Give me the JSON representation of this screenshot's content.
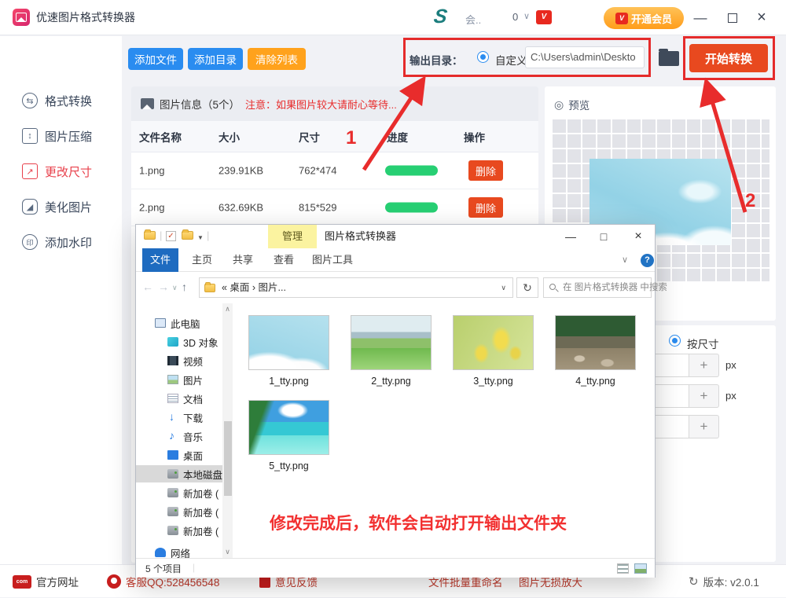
{
  "app": {
    "title": "优速图片格式转换器",
    "titlebar": {
      "logo": "S",
      "account": "会..",
      "count": "0",
      "chevron": "∨",
      "vip_badge": "V",
      "upgrade": "开通会员",
      "minimize": "—",
      "close": "×"
    },
    "sidebar": {
      "items": [
        {
          "label": "格式转换",
          "icon_glyph": "⇆"
        },
        {
          "label": "图片压缩",
          "icon_glyph": "↕"
        },
        {
          "label": "更改尺寸",
          "icon_glyph": "↗"
        },
        {
          "label": "美化图片",
          "icon_glyph": "◢"
        },
        {
          "label": "添加水印",
          "icon_glyph": "印"
        }
      ]
    },
    "toolbar": {
      "add_files": "添加文件",
      "add_folder": "添加目录",
      "clear_list": "清除列表"
    },
    "output": {
      "label": "输出目录：",
      "custom": "自定义",
      "path": "C:\\Users\\admin\\Deskto",
      "start": "开始转换"
    },
    "table": {
      "panel_title": "图片信息（5个）",
      "warning": "注意：如果图片较大请耐心等待...",
      "columns": {
        "name": "文件名称",
        "size": "大小",
        "dims": "尺寸",
        "progress": "进度",
        "action": "操作"
      },
      "rows": [
        {
          "name": "1.png",
          "size": "239.91KB",
          "dims": "762*474",
          "progress_pct": 100,
          "action": "删除"
        },
        {
          "name": "2.png",
          "size": "632.69KB",
          "dims": "815*529",
          "progress_pct": 100,
          "action": "删除"
        }
      ]
    },
    "preview": {
      "title": "预览",
      "eye_glyph": "◎"
    },
    "resize": {
      "by_size": "按尺寸",
      "plus": "+",
      "px1": "px",
      "px2": "px"
    },
    "footer": {
      "site": "官方网址",
      "site_icon": "com",
      "qq": "客服QQ:528456548",
      "feedback": "意见反馈",
      "rename": "文件批量重命名",
      "enlarge": "图片无损放大",
      "refresh_glyph": "↻",
      "version": "版本: v2.0.1"
    }
  },
  "explorer": {
    "manage": "管理",
    "title": "图片格式转换器",
    "window": {
      "minimize": "—",
      "maximize": "□",
      "close": "×",
      "help": "?",
      "chevron": "∨",
      "check": "✓",
      "qat_drop": "▼"
    },
    "tabs": [
      {
        "label": "文件"
      },
      {
        "label": "主页"
      },
      {
        "label": "共享"
      },
      {
        "label": "查看"
      },
      {
        "label": "图片工具"
      }
    ],
    "nav": {
      "back": "←",
      "forward": "→",
      "drop": "∨",
      "up": "↑",
      "refresh": "↻"
    },
    "address": "« 桌面 › 图片...",
    "address_chevron": "∨",
    "search_placeholder": "在 图片格式转换器 中搜索",
    "tree": [
      {
        "label": "此电脑"
      },
      {
        "label": "3D 对象"
      },
      {
        "label": "视频"
      },
      {
        "label": "图片"
      },
      {
        "label": "文档"
      },
      {
        "label": "下载"
      },
      {
        "label": "音乐"
      },
      {
        "label": "桌面"
      },
      {
        "label": "本地磁盘"
      },
      {
        "label": "新加卷 ("
      },
      {
        "label": "新加卷 ("
      },
      {
        "label": "新加卷 ("
      },
      {
        "label": "网络"
      }
    ],
    "scroll": {
      "up": "∧",
      "down": "∨"
    },
    "files": [
      {
        "name": "1_tty.png"
      },
      {
        "name": "2_tty.png"
      },
      {
        "name": "3_tty.png"
      },
      {
        "name": "4_tty.png"
      },
      {
        "name": "5_tty.png"
      }
    ],
    "status": "5 个项目"
  },
  "annotations": {
    "step1": "1",
    "step2": "2",
    "note": "修改完成后，软件会自动打开输出文件夹"
  },
  "colors": {
    "accent_blue": "#2a8cf0",
    "accent_orange": "#ffa21c",
    "action_red": "#e8491f",
    "progress_green": "#27cf73",
    "annotation_red": "#e82c2c",
    "explorer_tab_blue": "#1e6bc0",
    "manage_tab_yellow": "#fbf3a0"
  }
}
